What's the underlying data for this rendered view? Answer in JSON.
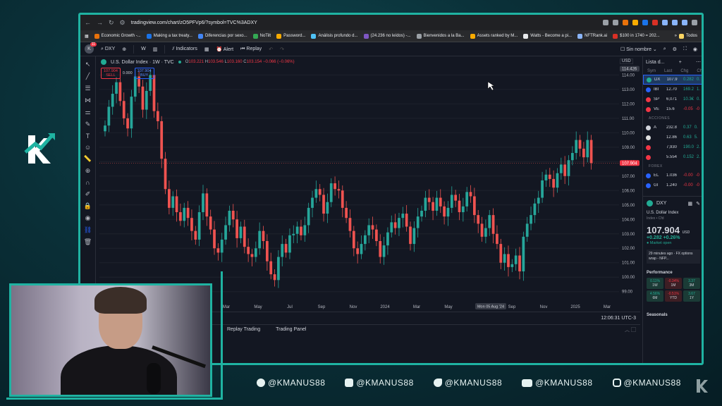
{
  "browser": {
    "url": "tradingview.com/chart/zO5PFVp6/?symbol=TVC%3ADXY",
    "bookmarks": [
      "Economic Growth -...",
      "Making a tax treaty...",
      "Diferencias por sexo...",
      "NoTilt",
      "Password...",
      "Análisis profundo d...",
      "(24.236 no leídos) -...",
      "Bienvenidos a la Ba...",
      "Assets ranked by M...",
      "Watts - Become a pi...",
      "NFTRank.ai",
      "$100 in 1740 = 202...",
      "Todos"
    ]
  },
  "toolbar": {
    "avatar_letter": "K",
    "notif_count": "11",
    "symbol": "DXY",
    "interval": "W",
    "indicators": "Indicators",
    "alert": "Alert",
    "replay": "Replay",
    "layout_name": "Sin nombre"
  },
  "chart_header": {
    "title": "U.S. Dollar Index · 1W · TVC",
    "o": "O",
    "o_val": "103.221",
    "h": "H",
    "h_val": "103.546",
    "l": "L",
    "l_val": "103.160",
    "c": "C",
    "c_val": "103.154",
    "chg": "−0.066 (−0.06%)",
    "sell_price": "107.904",
    "sell_label": "SELL",
    "spread": "0.000",
    "buy_price": "107.904",
    "buy_label": "BUY",
    "currency": "USD"
  },
  "chart_data": {
    "type": "candlestick",
    "x_ticks": [
      "Mar",
      "May",
      "Jul",
      "Sep",
      "Nov",
      "2024",
      "Mar",
      "May",
      "Jul",
      "Sep",
      "Nov",
      "2025",
      "Mar"
    ],
    "y_ticks": [
      99.0,
      100.0,
      101.0,
      102.0,
      103.0,
      104.0,
      105.0,
      106.0,
      107.0,
      108.0,
      109.0,
      110.0,
      111.0,
      112.0,
      113.0,
      114.0
    ],
    "ylim": [
      98.4,
      114.8
    ],
    "crosshair_price": "114.426",
    "last_price": "107.904",
    "crosshair_date": "Mon 05 Aug '24",
    "closes": [
      110.5,
      111.8,
      112.7,
      113.5,
      112.2,
      111.0,
      110.3,
      112.5,
      113.9,
      113.2,
      111.6,
      112.9,
      114.0,
      111.5,
      110.8,
      108.2,
      106.1,
      104.8,
      105.6,
      104.5,
      103.9,
      104.8,
      104.1,
      103.2,
      102.6,
      104.5,
      105.8,
      104.2,
      103.3,
      102.0,
      101.7,
      102.6,
      103.6,
      104.6,
      104.0,
      102.7,
      103.5,
      102.1,
      101.6,
      101.4,
      102.0,
      103.2,
      102.5,
      101.1,
      100.2,
      99.8,
      101.4,
      102.3,
      101.7,
      102.9,
      103.0,
      103.5,
      102.9,
      103.6,
      104.8,
      105.5,
      106.1,
      105.7,
      104.4,
      105.2,
      106.5,
      106.1,
      106.0,
      104.8,
      104.1,
      103.2,
      102.0,
      101.6,
      102.3,
      102.9,
      103.6,
      103.3,
      102.5,
      101.4,
      102.2,
      103.1,
      103.8,
      103.4,
      104.1,
      104.4,
      103.5,
      102.3,
      103.4,
      104.2,
      104.6,
      105.5,
      105.2,
      104.6,
      105.5,
      104.9,
      104.2,
      104.8,
      105.7,
      105.3,
      104.5,
      104.9,
      105.9,
      105.6,
      104.3,
      103.7,
      102.8,
      103.4,
      104.3,
      103.0,
      102.3,
      101.0,
      101.6,
      100.7,
      100.9,
      101.5,
      100.4,
      102.8,
      103.7,
      104.3,
      105.1,
      105.5,
      106.7,
      107.1,
      106.8,
      106.2,
      107.2,
      107.8,
      107.0,
      108.1,
      108.6,
      109.5,
      108.9,
      108.3,
      109.5,
      107.9
    ]
  },
  "time_readout": "12:06:31 UTC-3",
  "panels": {
    "replay_trading": "Replay Trading",
    "trading_panel": "Trading Panel"
  },
  "watchlist": {
    "title": "Lista d...",
    "cols": [
      "Sym",
      "Last",
      "Chg",
      "Ch"
    ],
    "rows": [
      {
        "sym": "DX",
        "last": "107.9",
        "chg": "0.282",
        "chp": "0.",
        "dir": "up",
        "color": "#22ab94",
        "selected": true
      },
      {
        "sym": "IBI",
        "last": "12.70",
        "chg": "169.2",
        "chp": "1.",
        "dir": "up",
        "color": "#2962ff"
      },
      {
        "sym": "SP",
        "last": "6,071",
        "chg": "10.3€",
        "chp": "0.",
        "dir": "up",
        "color": "#f23645"
      },
      {
        "sym": "VE",
        "last": "15.6",
        "chg": "-0.05",
        "chp": "-0",
        "dir": "dn",
        "color": "#f23645"
      }
    ],
    "section_acciones": "ACCIONES",
    "acciones": [
      {
        "sym": "A",
        "last": "232.8",
        "chg": "0.37",
        "chp": "0.",
        "dir": "up",
        "color": "#d1d4dc"
      },
      {
        "sym": "",
        "last": "12.86",
        "chg": "0.63",
        "chp": "5.",
        "dir": "up",
        "color": "#e0e0e0"
      },
      {
        "sym": "",
        "last": "7,930",
        "chg": "190.0",
        "chp": "2.",
        "dir": "up",
        "color": "#f23645"
      },
      {
        "sym": "",
        "last": "5.554",
        "chg": "0.152",
        "chp": "2.",
        "dir": "up",
        "color": "#f23645"
      }
    ],
    "section_forex": "FOREX",
    "forex": [
      {
        "sym": "EL",
        "last": "1.036",
        "chg": "-0.00",
        "chp": "-0",
        "dir": "dn",
        "color": "#2962ff"
      },
      {
        "sym": "GI",
        "last": "1.240",
        "chg": "-0.00",
        "chp": "-0",
        "dir": "dn",
        "color": "#2962ff"
      }
    ]
  },
  "detail": {
    "sym": "DXY",
    "name": "U.S. Dollar Index",
    "sub": "Index • Cfd",
    "price": "107.904",
    "unit": "USD",
    "chg": "+0.282",
    "chgp": "+0.26%",
    "market": "Market open",
    "news": "29 minutes ago · FX options wrap - NFP...",
    "perf_title": "Performance",
    "perf": [
      {
        "v": "0.11%",
        "l": "1W",
        "t": "pos"
      },
      {
        "v": "-0.34%",
        "l": "1M",
        "t": "neg"
      },
      {
        "v": "3.37",
        "l": "3M",
        "t": "pos"
      },
      {
        "v": "4.56%",
        "l": "6M",
        "t": "pos"
      },
      {
        "v": "-0.51%",
        "l": "YTD",
        "t": "neg"
      },
      {
        "v": "3.67",
        "l": "1Y",
        "t": "pos"
      }
    ],
    "seasonals": "Seasonals"
  },
  "socials": [
    "@KMANUS88",
    "@KMANUS88",
    "@KMANUS88",
    "@KMANUS88",
    "@KMANUS88"
  ]
}
